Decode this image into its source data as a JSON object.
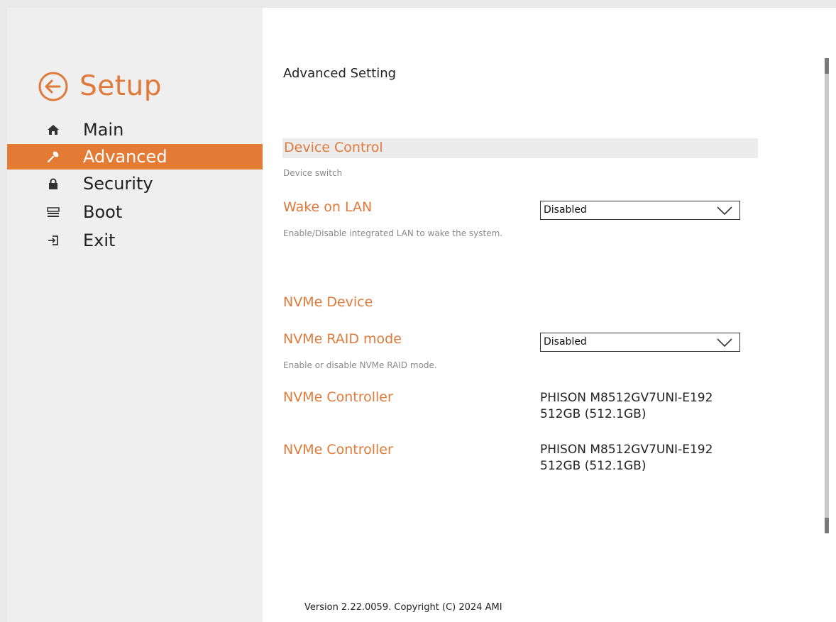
{
  "colors": {
    "accent": "#e47b35",
    "accent_text": "#e07a3a",
    "sidebar_bg": "#efefef"
  },
  "sidebar": {
    "title": "Setup",
    "back_icon": "back-arrow-circle-icon",
    "items": [
      {
        "label": "Main",
        "icon": "home-icon",
        "active": false
      },
      {
        "label": "Advanced",
        "icon": "wrench-icon",
        "active": true
      },
      {
        "label": "Security",
        "icon": "lock-icon",
        "active": false
      },
      {
        "label": "Boot",
        "icon": "drive-icon",
        "active": false
      },
      {
        "label": "Exit",
        "icon": "exit-icon",
        "active": false
      }
    ]
  },
  "main": {
    "title": "Advanced Setting",
    "section_device_control": {
      "header": "Device Control",
      "description": "Device switch",
      "wake_on_lan": {
        "label": "Wake on LAN",
        "value": "Disabled",
        "help": "Enable/Disable integrated LAN to wake the system."
      }
    },
    "section_nvme": {
      "header": "NVMe Device",
      "raid_mode": {
        "label": "NVMe RAID mode",
        "value": "Disabled",
        "help": "Enable or disable NVMe RAID mode."
      },
      "controllers": [
        {
          "label": "NVMe Controller",
          "line1": "PHISON M8512GV7UNI-E192",
          "line2": "512GB (512.1GB)"
        },
        {
          "label": "NVMe Controller",
          "line1": "PHISON M8512GV7UNI-E192",
          "line2": "512GB (512.1GB)"
        }
      ]
    }
  },
  "footer": {
    "version": "Version 2.22.0059. Copyright (C) 2024 AMI"
  }
}
